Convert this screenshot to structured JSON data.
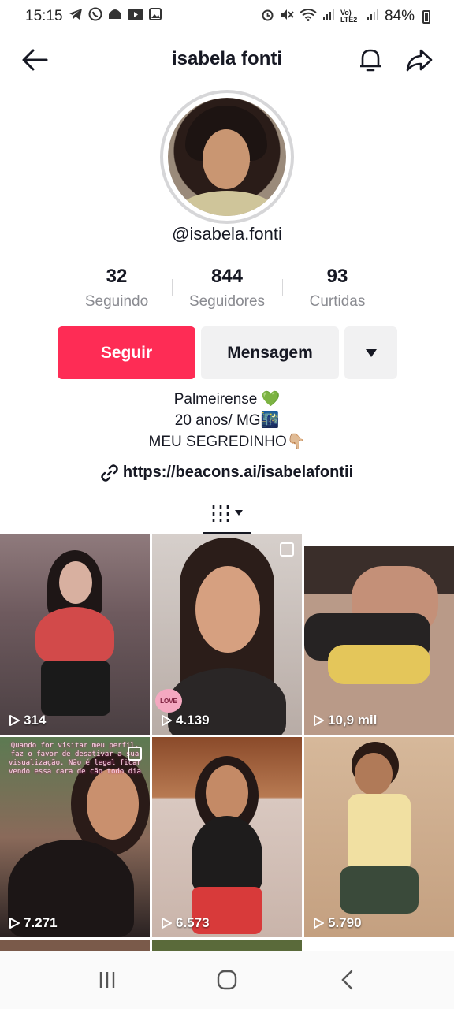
{
  "status": {
    "time": "15:15",
    "network": "Vo) LTE2",
    "battery": "84%"
  },
  "header": {
    "title": "isabela fonti"
  },
  "profile": {
    "handle": "@isabela.fonti",
    "stats": [
      {
        "value": "32",
        "label": "Seguindo"
      },
      {
        "value": "844",
        "label": "Seguidores"
      },
      {
        "value": "93",
        "label": "Curtidas"
      }
    ],
    "follow_label": "Seguir",
    "message_label": "Mensagem",
    "bio": {
      "line1": "Palmeirense 💚",
      "line2": "20 anos/ MG🌃",
      "line3": "MEU SEGREDINHO👇🏼"
    },
    "link": "https://beacons.ai/isabelafontii"
  },
  "videos": [
    {
      "views": "314"
    },
    {
      "views": "4.139",
      "sticker": "LOVE"
    },
    {
      "views": "10,9 mil"
    },
    {
      "views": "7.271",
      "caption": "Quando for visitar meu perfil, faz o favor de desativar a sua visualização. Não é legal ficar vendo essa cara de cão todo dia"
    },
    {
      "views": "6.573"
    },
    {
      "views": "5.790"
    }
  ],
  "colors": {
    "accent": "#fe2c55",
    "secondary_button": "#f1f1f2",
    "muted_text": "#8a8b91"
  }
}
